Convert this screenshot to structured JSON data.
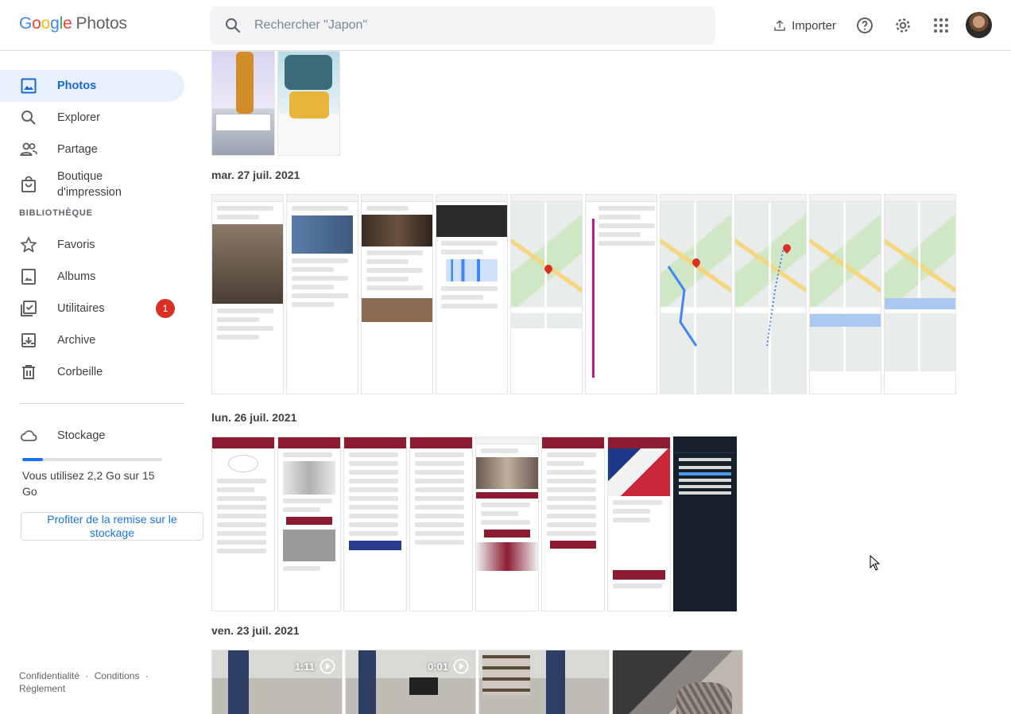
{
  "app": {
    "logo_letters": [
      "G",
      "o",
      "o",
      "g",
      "l",
      "e"
    ],
    "product": "Photos"
  },
  "search": {
    "placeholder": "Rechercher \"Japon\""
  },
  "header": {
    "import_label": "Importer",
    "icons": [
      "upload-icon",
      "help-icon",
      "settings-icon",
      "apps-icon"
    ]
  },
  "nav": {
    "items": [
      {
        "label": "Photos",
        "icon": "photos-icon",
        "active": true
      },
      {
        "label": "Explorer",
        "icon": "search-icon"
      },
      {
        "label": "Partage",
        "icon": "people-icon"
      },
      {
        "label": "Boutique d'impression",
        "icon": "shopping-bag-icon"
      }
    ],
    "library_title": "BIBLIOTHÈQUE",
    "library": [
      {
        "label": "Favoris",
        "icon": "star-icon"
      },
      {
        "label": "Albums",
        "icon": "album-icon"
      },
      {
        "label": "Utilitaires",
        "icon": "utilities-icon",
        "badge": "1"
      },
      {
        "label": "Archive",
        "icon": "archive-icon"
      },
      {
        "label": "Corbeille",
        "icon": "trash-icon"
      }
    ],
    "storage": {
      "label": "Stockage",
      "icon": "cloud-icon",
      "used_fraction": 0.147,
      "usage_text": "Vous utilisez 2,2 Go sur 15 Go",
      "promo": "Profiter de la remise sur le stockage"
    },
    "footer": [
      "Confidentialité",
      "·",
      "Conditions",
      "·",
      "Règlement"
    ]
  },
  "colors": {
    "accent": "#1a73e8",
    "active_bg": "#e8f0fe",
    "badge": "#d93025",
    "olympic_red": "#8b1c31"
  },
  "sections": [
    {
      "date": "mar. 27 juil. 2021",
      "count": 10
    },
    {
      "date": "lun. 26 juil. 2021",
      "count": 8
    },
    {
      "date": "ven. 23 juil. 2021",
      "count": 4
    }
  ],
  "videos": [
    {
      "duration": "1:11"
    },
    {
      "duration": "0:01"
    }
  ]
}
